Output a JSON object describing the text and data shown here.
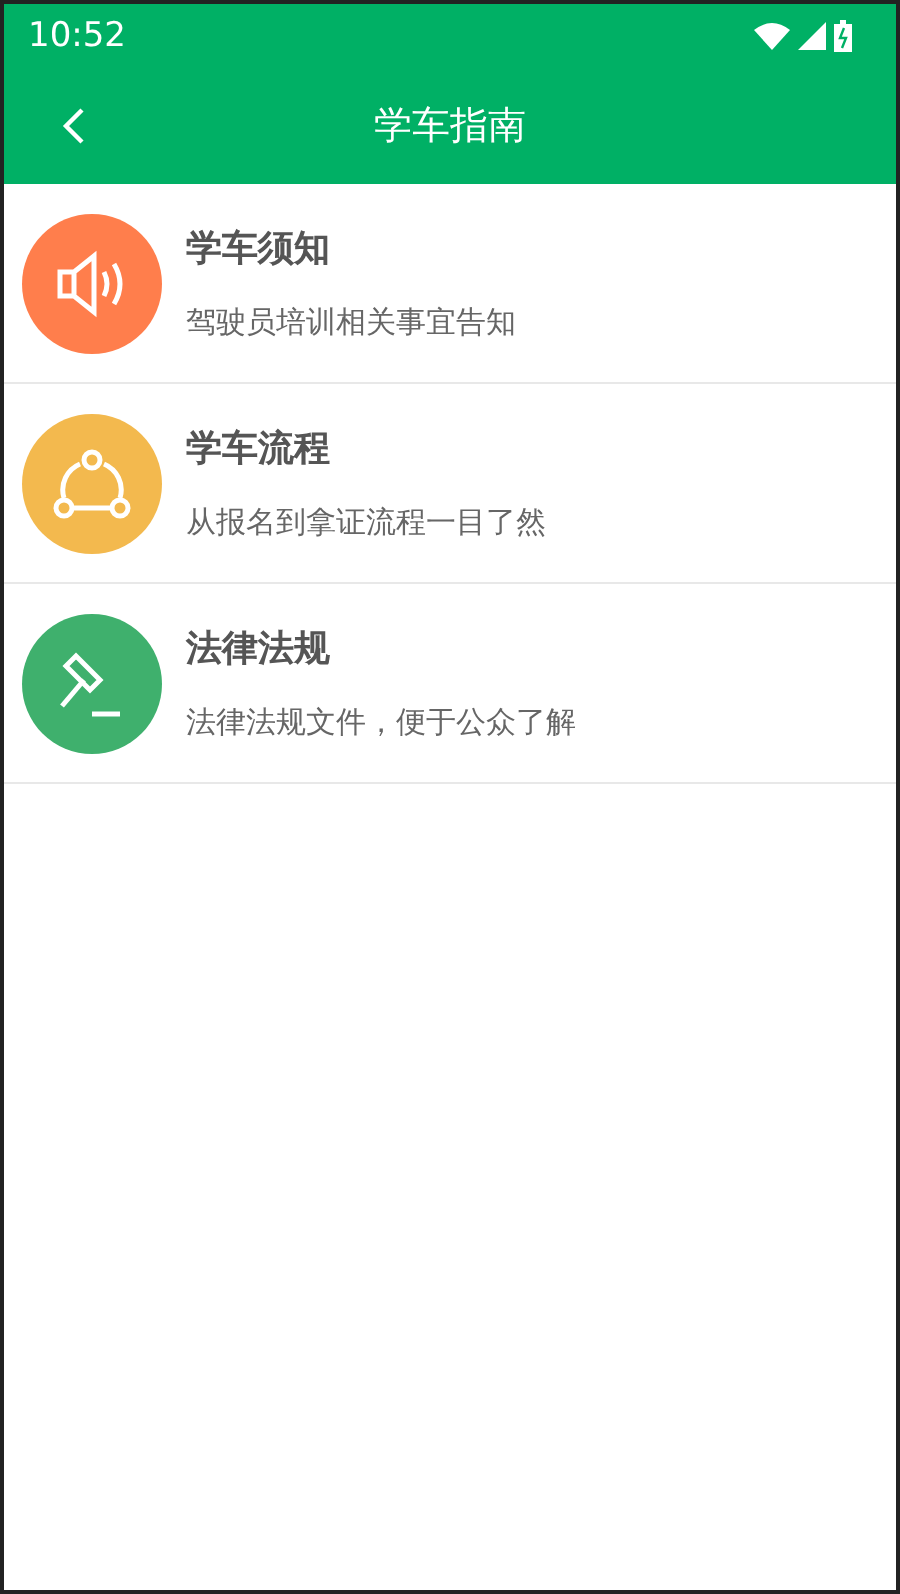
{
  "status_bar": {
    "time": "10:52"
  },
  "toolbar": {
    "title": "学车指南"
  },
  "items": [
    {
      "kind": "speaker",
      "color": "#ff7e4c",
      "title": "学车须知",
      "subtitle": "驾驶员培训相关事宜告知"
    },
    {
      "kind": "share",
      "color": "#f3b94e",
      "title": "学车流程",
      "subtitle": "从报名到拿证流程一目了然"
    },
    {
      "kind": "gavel",
      "color": "#3fb06d",
      "title": "法律法规",
      "subtitle": "法律法规文件，便于公众了解"
    }
  ]
}
